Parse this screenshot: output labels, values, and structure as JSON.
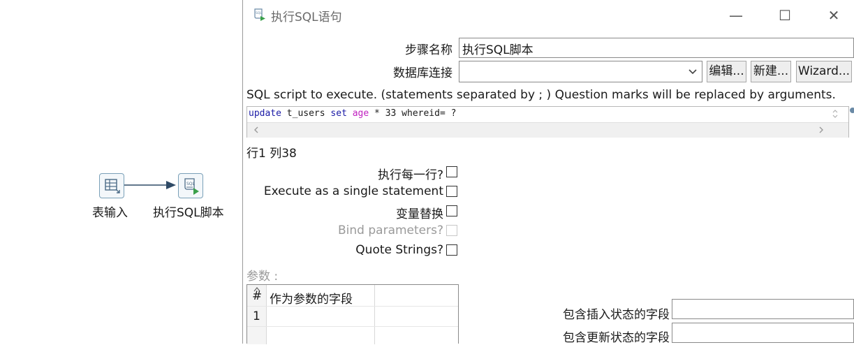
{
  "canvas": {
    "step1": {
      "label": "表输入",
      "icon": "table-input-icon"
    },
    "step2": {
      "label": "执行SQL脚本",
      "icon": "sql-script-icon"
    },
    "colors": {
      "arrow": "#2f4a66",
      "icon_border": "#7aa0b8"
    }
  },
  "dialog": {
    "title": "执行SQL语句",
    "controls": {
      "minimize": "—",
      "maximize": "☐",
      "close": "✕"
    },
    "step_name": {
      "label": "步骤名称",
      "value": "执行SQL脚本"
    },
    "db_connection": {
      "label": "数据库连接",
      "value": "",
      "buttons": {
        "edit": "编辑...",
        "new": "新建...",
        "wizard": "Wizard..."
      }
    },
    "sql": {
      "description": "SQL script to execute. (statements separated by ; ) Question marks will be replaced by arguments.",
      "tokens": {
        "kw_update": "update",
        "t1": " t_users ",
        "kw_set": "set",
        "t2": " ",
        "kw_age": "age",
        "t3": " * 33 whereid= ?"
      },
      "cursor_position": "行1 列38",
      "colors": {
        "keyword": "#1a1aa6",
        "field": "#c020c0"
      }
    },
    "options": {
      "execute_each_row": {
        "label": "执行每一行?",
        "checked": false
      },
      "single_statement": {
        "label": "Execute as a single statement",
        "checked": false
      },
      "variable_substitution": {
        "label": "变量替换",
        "checked": false
      },
      "bind_parameters": {
        "label": "Bind parameters?",
        "checked": false,
        "enabled": false
      },
      "quote_strings": {
        "label": "Quote Strings?",
        "checked": false
      }
    },
    "parameters": {
      "label": "参数 :",
      "headers": {
        "num": "#",
        "field": "作为参数的字段"
      },
      "rows": [
        {
          "num": "1",
          "field": ""
        }
      ]
    },
    "status_fields": {
      "insert": {
        "label": "包含插入状态的字段",
        "value": ""
      },
      "update": {
        "label": "包含更新状态的字段",
        "value": ""
      }
    }
  }
}
